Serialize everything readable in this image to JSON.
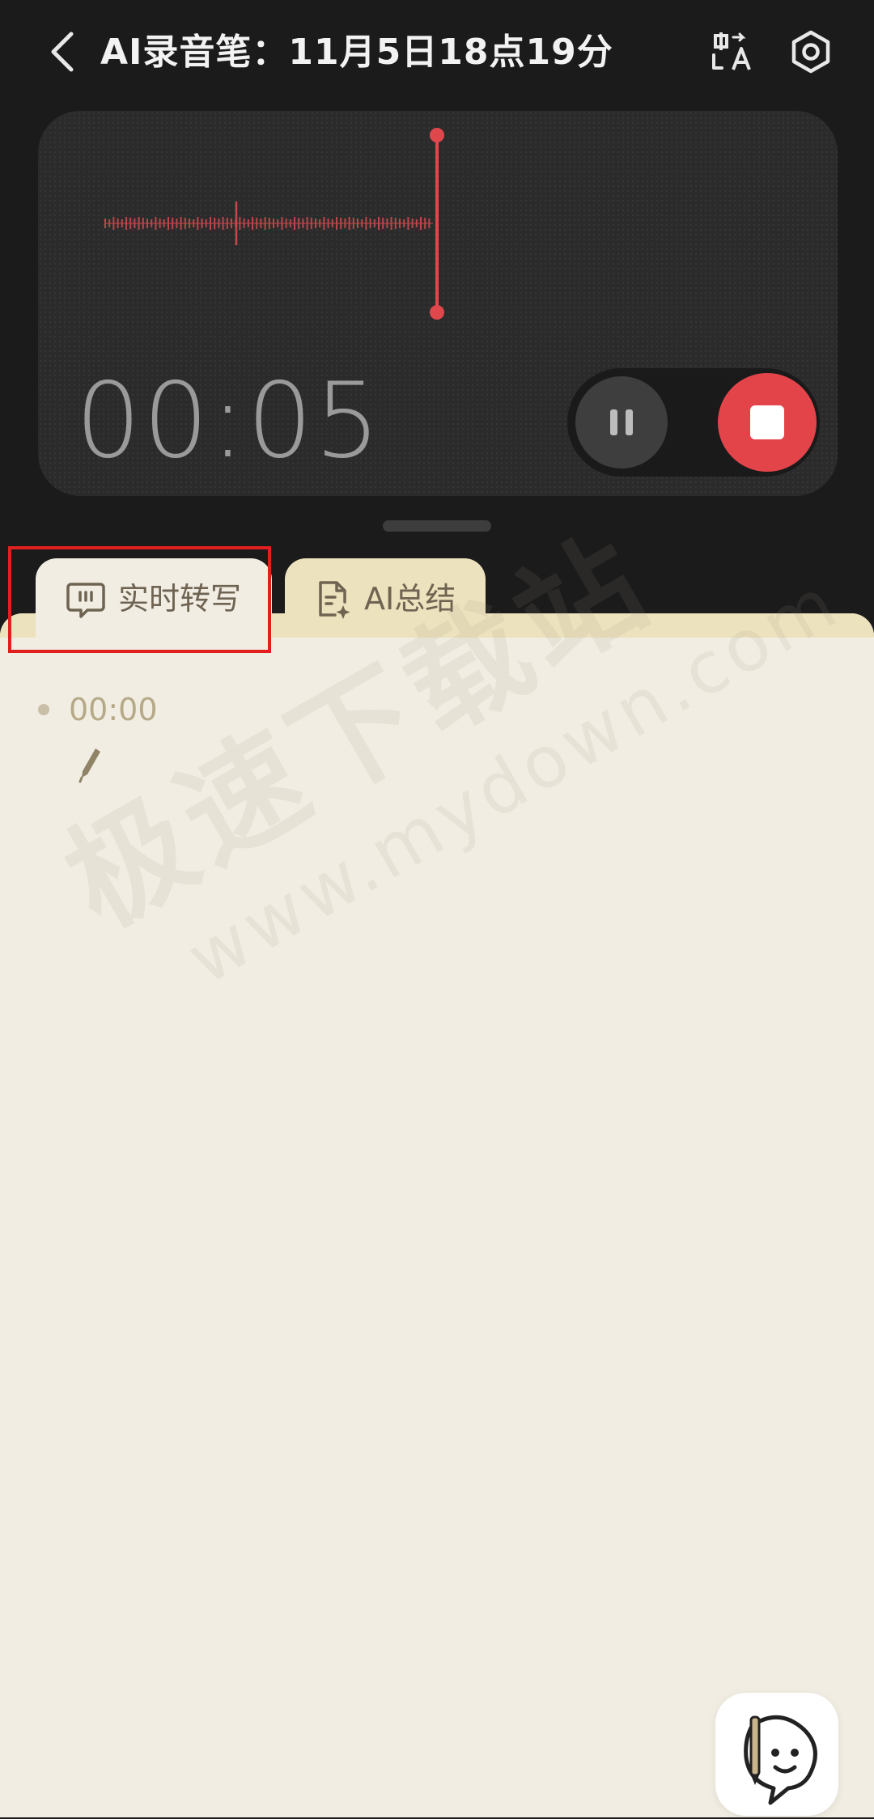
{
  "header": {
    "title": "AI录音笔：11月5日18点19分"
  },
  "recorder": {
    "elapsed": "00:05",
    "status": "recording",
    "accent_color": "#e3444a"
  },
  "tabs": [
    {
      "label": "实时转写",
      "icon": "chat-transcript-icon",
      "selected": true
    },
    {
      "label": "AI总结",
      "icon": "document-sparkle-icon",
      "selected": false
    }
  ],
  "transcript": {
    "entries": [
      {
        "time": "00:00",
        "text": ""
      }
    ]
  },
  "watermark": {
    "text_cn": "极速下载站",
    "text_en": "www.mydown.com"
  },
  "icons": {
    "back": "chevron-left-icon",
    "translate": "translate-icon",
    "settings": "gear-icon",
    "pause": "pause-icon",
    "stop": "stop-icon",
    "edit": "pen-icon",
    "assistant": "assistant-mascot-icon"
  }
}
